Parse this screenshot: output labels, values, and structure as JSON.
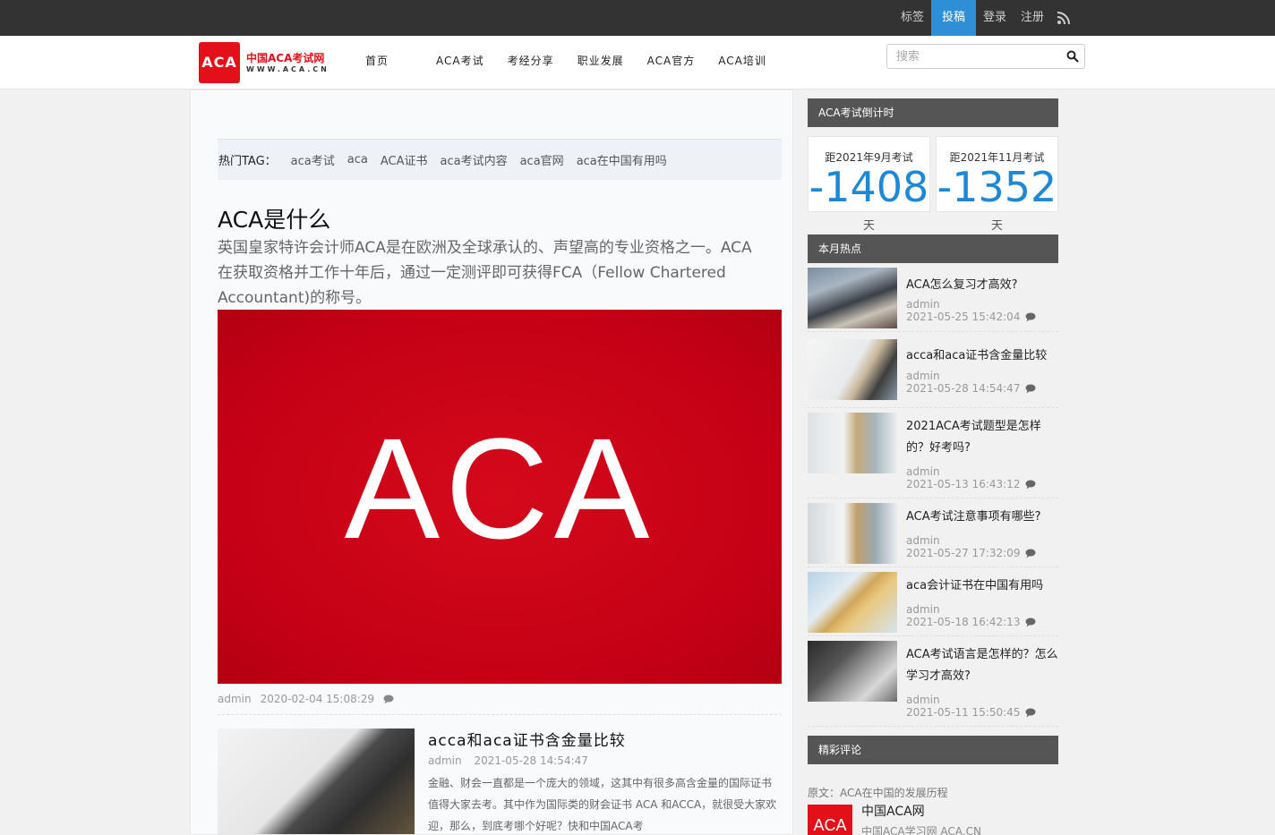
{
  "topbar": {
    "links": [
      "标签",
      "投稿",
      "登录",
      "注册"
    ],
    "active_index": 1
  },
  "header": {
    "logo_mark": "ACA",
    "logo_name": "中国ACA考试网",
    "logo_url": "WWW.ACA.CN",
    "nav": [
      "首页",
      "ACA考试",
      "考经分享",
      "职业发展",
      "ACA官方",
      "ACA培训"
    ],
    "search_placeholder": "搜索"
  },
  "main": {
    "hottag_label": "热门TAG：",
    "tags": [
      "aca考试",
      "aca",
      "ACA证书",
      "aca考试内容",
      "aca官网",
      "aca在中国有用吗"
    ],
    "featured": {
      "title": "ACA是什么",
      "desc": "英国皇家特许会计师ACA是在欧洲及全球承认的、声望高的专业资格之一。ACA在获取资格并工作十年后，通过一定测评即可获得FCA（Fellow Chartered Accountant)的称号。",
      "banner_text": "ACA",
      "author": "admin",
      "date": "2020-02-04 15:08:29"
    },
    "post2": {
      "title": "acca和aca证书含金量比较",
      "author": "admin",
      "date": "2021-05-28 14:54:47",
      "desc": "金融、财会一直都是一个庞大的领域，这其中有很多高含金量的国际证书值得大家去考。其中作为国际类的财会证书 ACA 和ACCA，就很受大家欢迎，那么，到底考哪个好呢？快和中国ACA考"
    }
  },
  "sidebar": {
    "countdown_title": "ACA考试倒计时",
    "countdowns": [
      {
        "label": "距2021年9月考试",
        "value": "-1408",
        "unit": "天"
      },
      {
        "label": "距2021年11月考试",
        "value": "-1352",
        "unit": "天"
      }
    ],
    "hot_title": "本月热点",
    "hot": [
      {
        "title": "ACA怎么复习才高效?",
        "author": "admin",
        "date": "2021-05-25 15:42:04"
      },
      {
        "title": "acca和aca证书含金量比较",
        "author": "admin",
        "date": "2021-05-28 14:54:47"
      },
      {
        "title": "2021ACA考试题型是怎样的？好考吗?",
        "author": "admin",
        "date": "2021-05-13 16:43:12"
      },
      {
        "title": "ACA考试注意事项有哪些?",
        "author": "admin",
        "date": "2021-05-27 17:32:09"
      },
      {
        "title": "aca会计证书在中国有用吗",
        "author": "admin",
        "date": "2021-05-18 16:42:13"
      },
      {
        "title": "ACA考试语言是怎样的？怎么学习才高效?",
        "author": "admin",
        "date": "2021-05-11 15:50:45"
      }
    ],
    "comments_title": "精彩评论",
    "comment": {
      "source": "原文：ACA在中国的发展历程",
      "avatar_text": "ACA",
      "name": "中国ACA网",
      "text": "中国ACA学习网 ACA.CN"
    }
  }
}
